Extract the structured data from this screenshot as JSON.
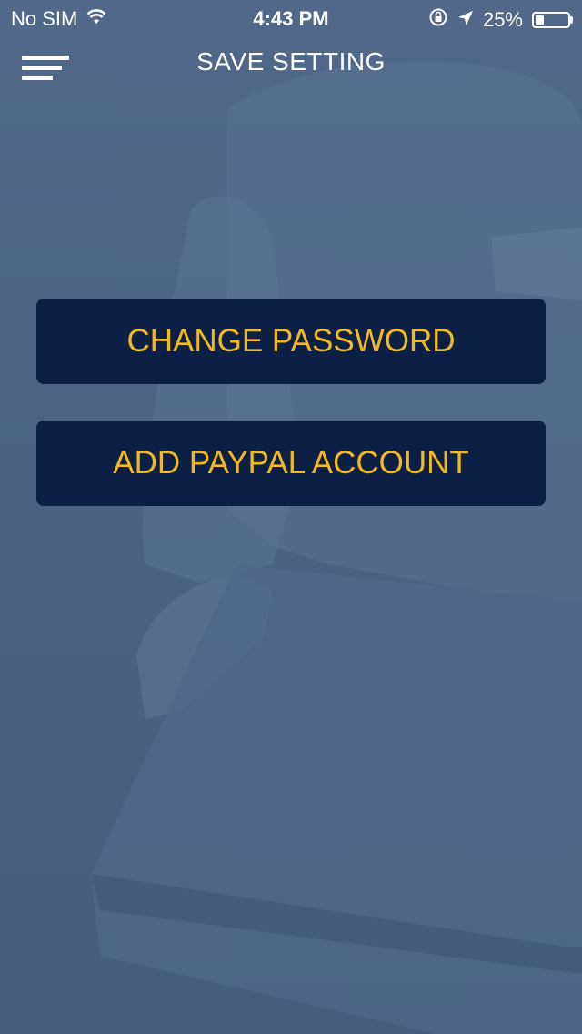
{
  "status_bar": {
    "carrier": "No SIM",
    "time": "4:43 PM",
    "battery_percent": "25%",
    "battery_level": 0.25,
    "icons": [
      "wifi-icon",
      "orientation-lock-icon",
      "location-arrow-icon",
      "battery-icon"
    ]
  },
  "nav": {
    "title": "SAVE SETTING",
    "menu_icon": "hamburger-menu-icon"
  },
  "actions": {
    "change_password_label": "CHANGE PASSWORD",
    "add_paypal_label": "ADD PAYPAL ACCOUNT"
  },
  "colors": {
    "background": "#4a6280",
    "button_bg": "#0c1f45",
    "button_text": "#f2b822",
    "text": "#ffffff"
  }
}
